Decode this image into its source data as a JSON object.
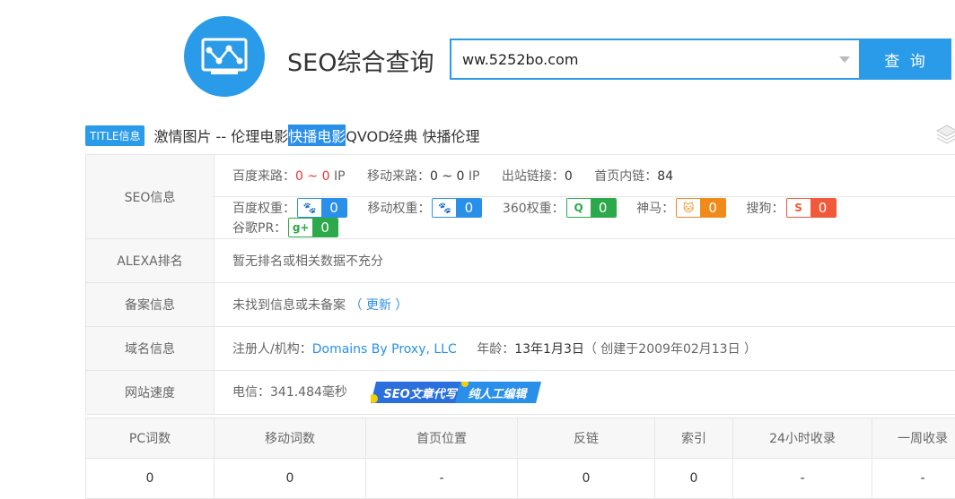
{
  "header": {
    "brand": "SEO综合查询",
    "search_value": "ww.5252bo.com",
    "search_button": "查 询"
  },
  "title_info": {
    "badge": "TITLE信息",
    "text_before": "激情图片 -- 伦理电影 ",
    "highlighted": "快播电影",
    "text_after": " QVOD经典 快播伦理"
  },
  "seo": {
    "label": "SEO信息",
    "baidu_traffic_label": "百度来路：",
    "baidu_traffic_from": "0",
    "baidu_traffic_sep": "~",
    "baidu_traffic_to": "0",
    "ip_unit": "IP",
    "mobile_traffic_label": "移动来路：",
    "mobile_traffic_value": "0 ~ 0",
    "outbound_label": "出站链接：",
    "outbound_value": "0",
    "internal_label": "首页内链：",
    "internal_value": "84",
    "weights": [
      {
        "label": "百度权重：",
        "icon": "paw-icon",
        "glyph": "🐾",
        "value": "0",
        "color": "#2a8fe8"
      },
      {
        "label": "移动权重：",
        "icon": "paw-icon",
        "glyph": "🐾",
        "value": "0",
        "color": "#2a8fe8"
      },
      {
        "label": "360权重：",
        "icon": "360-icon",
        "glyph": "Q",
        "value": "0",
        "color": "#2ca94a"
      },
      {
        "label": "神马：",
        "icon": "shenma-icon",
        "glyph": "🐱",
        "value": "0",
        "color": "#f08a19"
      },
      {
        "label": "搜狗：",
        "icon": "sogou-icon",
        "glyph": "S",
        "value": "0",
        "color": "#f05a3a"
      },
      {
        "label": "谷歌PR：",
        "icon": "google-plus-icon",
        "glyph": "g+",
        "value": "0",
        "color": "#2ca94a"
      }
    ]
  },
  "alexa": {
    "label": "ALEXA排名",
    "value": "暂无排名或相关数据不充分"
  },
  "beian": {
    "label": "备案信息",
    "value": "未找到信息或未备案",
    "update_link": "（ 更新 ）"
  },
  "domain": {
    "label": "域名信息",
    "registrant_label": "注册人/机构：",
    "registrant_value": "Domains By Proxy, LLC",
    "age_label": "年龄：",
    "age_value": "13年1月3日",
    "created_note": "（ 创建于2009年02月13日 ）"
  },
  "speed": {
    "label": "网站速度",
    "value": "电信：341.484毫秒",
    "banner_left": "SEO文章代写",
    "banner_right": "纯人工编辑"
  },
  "stats": {
    "headers": [
      "PC词数",
      "移动词数",
      "首页位置",
      "反链",
      "索引",
      "24小时收录",
      "一周收录"
    ],
    "values": [
      "0",
      "0",
      "-",
      "0",
      "0",
      "-",
      "-"
    ]
  }
}
